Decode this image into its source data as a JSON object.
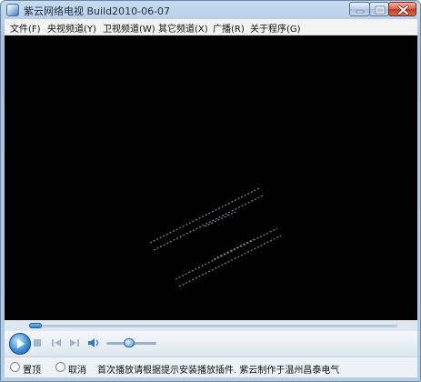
{
  "window": {
    "title": "紫云网络电视 Build2010-06-07"
  },
  "menu": {
    "items": [
      {
        "label": "文件(F)"
      },
      {
        "label": "央视频道(Y)"
      },
      {
        "label": "卫视频道(W)"
      },
      {
        "label": "其它频道(X)"
      },
      {
        "label": "广播(R)"
      },
      {
        "label": "关于程序(G)"
      }
    ]
  },
  "player": {
    "seek_fraction": 0.0,
    "volume_fraction": 0.45
  },
  "status": {
    "option_top": "置顶",
    "option_cancel": "取消",
    "message": "首次播放请根据提示安装播放插件. 紫云制作于温州昌泰电气"
  },
  "colors": {
    "video_background": "#000000",
    "accent": "#3b8ed6"
  }
}
